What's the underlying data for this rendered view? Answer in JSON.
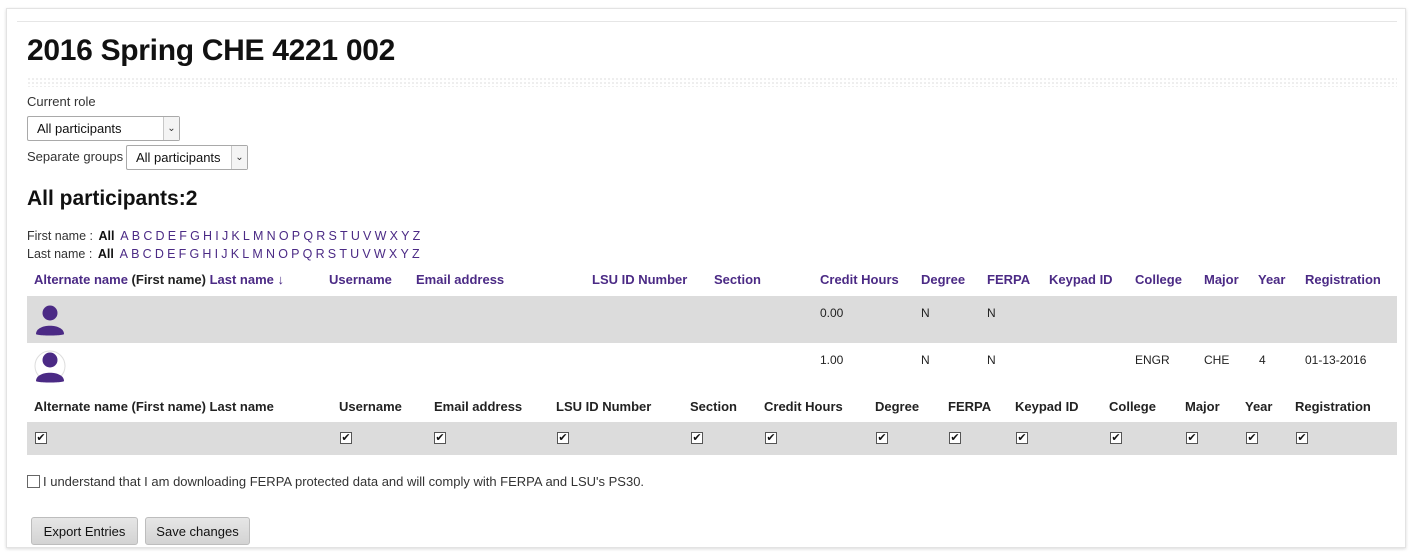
{
  "page_title": "2016 Spring CHE 4221 002",
  "role": {
    "label": "Current role",
    "selected": "All participants"
  },
  "groups": {
    "label": "Separate groups",
    "selected": "All participants"
  },
  "participants_heading": "All participants:2",
  "firstname_filter": {
    "label": "First name :",
    "selected": "All",
    "letters": [
      "A",
      "B",
      "C",
      "D",
      "E",
      "F",
      "G",
      "H",
      "I",
      "J",
      "K",
      "L",
      "M",
      "N",
      "O",
      "P",
      "Q",
      "R",
      "S",
      "T",
      "U",
      "V",
      "W",
      "X",
      "Y",
      "Z"
    ]
  },
  "lastname_filter": {
    "label": "Last name :",
    "selected": "All",
    "letters": [
      "A",
      "B",
      "C",
      "D",
      "E",
      "F",
      "G",
      "H",
      "I",
      "J",
      "K",
      "L",
      "M",
      "N",
      "O",
      "P",
      "Q",
      "R",
      "S",
      "T",
      "U",
      "V",
      "W",
      "X",
      "Y",
      "Z"
    ]
  },
  "table": {
    "headers": {
      "alternate_name": "Alternate name",
      "first_name": "(First name)",
      "last_name": "Last name",
      "sort_icon": "↓",
      "username": "Username",
      "email": "Email address",
      "lsu_id": "LSU ID Number",
      "section": "Section",
      "credit_hours": "Credit Hours",
      "degree": "Degree",
      "ferpa": "FERPA",
      "keypad_id": "Keypad ID",
      "college": "College",
      "major": "Major",
      "year": "Year",
      "registration": "Registration"
    },
    "rows": [
      {
        "credit_hours": "0.00",
        "degree": "N",
        "ferpa": "N",
        "college": "",
        "major": "",
        "year": "",
        "registration": ""
      },
      {
        "credit_hours": "1.00",
        "degree": "N",
        "ferpa": "N",
        "college": "ENGR",
        "major": "CHE",
        "year": "4",
        "registration": "01-13-2016"
      }
    ]
  },
  "export_columns": {
    "headers": [
      "Alternate name (First name) Last name",
      "Username",
      "Email address",
      "LSU ID Number",
      "Section",
      "Credit Hours",
      "Degree",
      "FERPA",
      "Keypad ID",
      "College",
      "Major",
      "Year",
      "Registration"
    ],
    "check_mark": "✔"
  },
  "ferpa_agreement": "I understand that I am downloading FERPA protected data and will comply with FERPA and LSU's PS30.",
  "buttons": {
    "export": "Export Entries",
    "save": "Save changes"
  },
  "colors": {
    "link": "#4b2a85",
    "row_bg": "#dcdcdc",
    "avatar": "#4b2a85"
  }
}
